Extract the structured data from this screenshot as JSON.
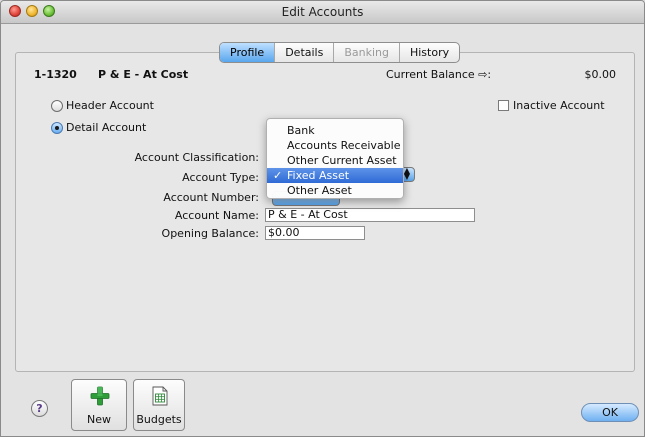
{
  "window": {
    "title": "Edit Accounts"
  },
  "tabs": [
    {
      "label": "Profile",
      "state": "selected"
    },
    {
      "label": "Details",
      "state": "normal"
    },
    {
      "label": "Banking",
      "state": "disabled"
    },
    {
      "label": "History",
      "state": "normal"
    }
  ],
  "account": {
    "number": "1-1320",
    "title": "P & E - At Cost",
    "balance_label": "Current Balance ⇨:",
    "balance_value": "$0.00"
  },
  "options": {
    "header_account": "Header Account",
    "detail_account": "Detail Account",
    "inactive_account": "Inactive Account",
    "selected": "detail"
  },
  "form": {
    "classification_label": "Account Classification:",
    "type_label": "Account Type:",
    "number_label": "Account Number:",
    "name_label": "Account Name:",
    "name_value": "P & E - At Cost",
    "opening_label": "Opening Balance:",
    "opening_value": "$0.00"
  },
  "account_type_menu": {
    "items": [
      "Bank",
      "Accounts Receivable",
      "Other Current Asset",
      "Fixed Asset",
      "Other Asset"
    ],
    "selected": "Fixed Asset",
    "check_glyph": "✓"
  },
  "footer": {
    "help_label": "?",
    "new_label": "New",
    "budgets_label": "Budgets",
    "ok_label": "OK"
  },
  "colors": {
    "accent": "#5aa6ee",
    "new_icon": "#2f9e3a",
    "budgets_icon": "#2f8a3a"
  }
}
